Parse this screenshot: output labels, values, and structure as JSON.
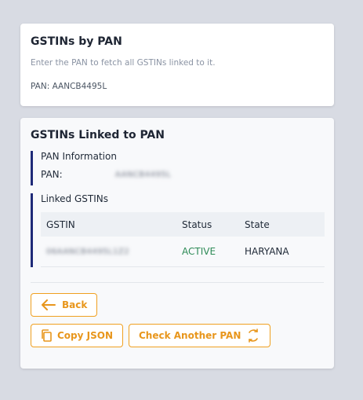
{
  "card1": {
    "title": "GSTINs by PAN",
    "subtitle": "Enter the PAN to fetch all GSTINs linked to it.",
    "pan_line": "PAN: AANCB4495L"
  },
  "card2": {
    "title": "GSTINs Linked to PAN",
    "pan_info": {
      "heading": "PAN Information",
      "label": "PAN:",
      "value": "AANCB4495L"
    },
    "linked": {
      "heading": "Linked GSTINs",
      "columns": [
        "GSTIN",
        "Status",
        "State"
      ],
      "rows": [
        {
          "gstin": "06AANCB4495L1Z2",
          "status": "ACTIVE",
          "state": "HARYANA"
        }
      ]
    },
    "buttons": {
      "back": "Back",
      "copy": "Copy JSON",
      "check_another": "Check Another PAN"
    }
  },
  "colors": {
    "accent": "#e8961c",
    "active_status": "#2e8b57",
    "section_border": "#1e2a78"
  },
  "icons": {
    "back": "arrow-left-icon",
    "copy": "copy-icon",
    "refresh": "refresh-icon"
  }
}
